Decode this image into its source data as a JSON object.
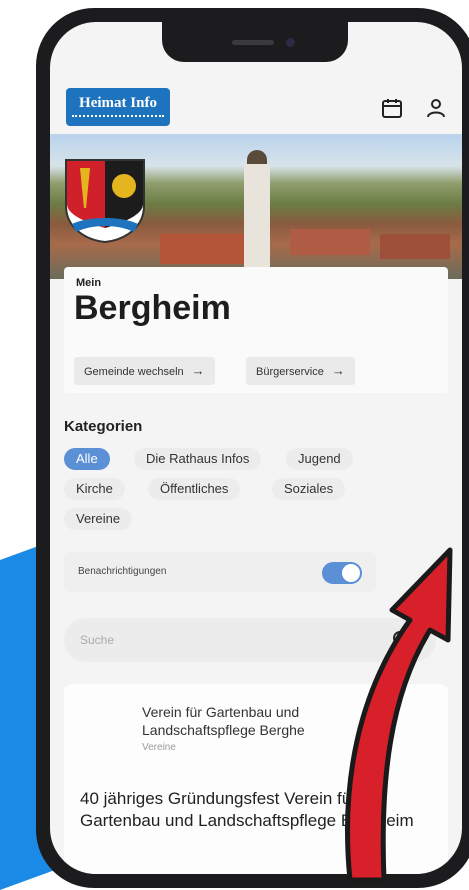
{
  "colors": {
    "accent": "#5b8fd6",
    "brand": "#1e73be",
    "highlight_arrow": "#d8202a"
  },
  "header": {
    "logo_text": "Heimat Info",
    "calendar_icon": "calendar-icon",
    "profile_icon": "person-icon"
  },
  "hero": {
    "crest_icon": "coat-of-arms-icon"
  },
  "location": {
    "prefix": "Mein",
    "town": "Bergheim",
    "change_button": "Gemeinde wechseln",
    "service_button": "Bürgerservice"
  },
  "categories": {
    "title": "Kategorien",
    "items": [
      "Alle",
      "Die Rathaus Infos",
      "Jugend",
      "Kirche",
      "Öffentliches",
      "Soziales",
      "Vereine"
    ],
    "selected": "Alle"
  },
  "notifications": {
    "label": "Benachrichtigungen",
    "enabled": true
  },
  "search": {
    "placeholder": "Suche"
  },
  "news": {
    "org_line1": "Verein für Gartenbau und",
    "org_line2": "Landschaftspflege Berghe",
    "category": "Vereine",
    "title": "40 jähriges Gründungsfest Verein für Gartenbau und Landschaftspflege Bergheim"
  }
}
